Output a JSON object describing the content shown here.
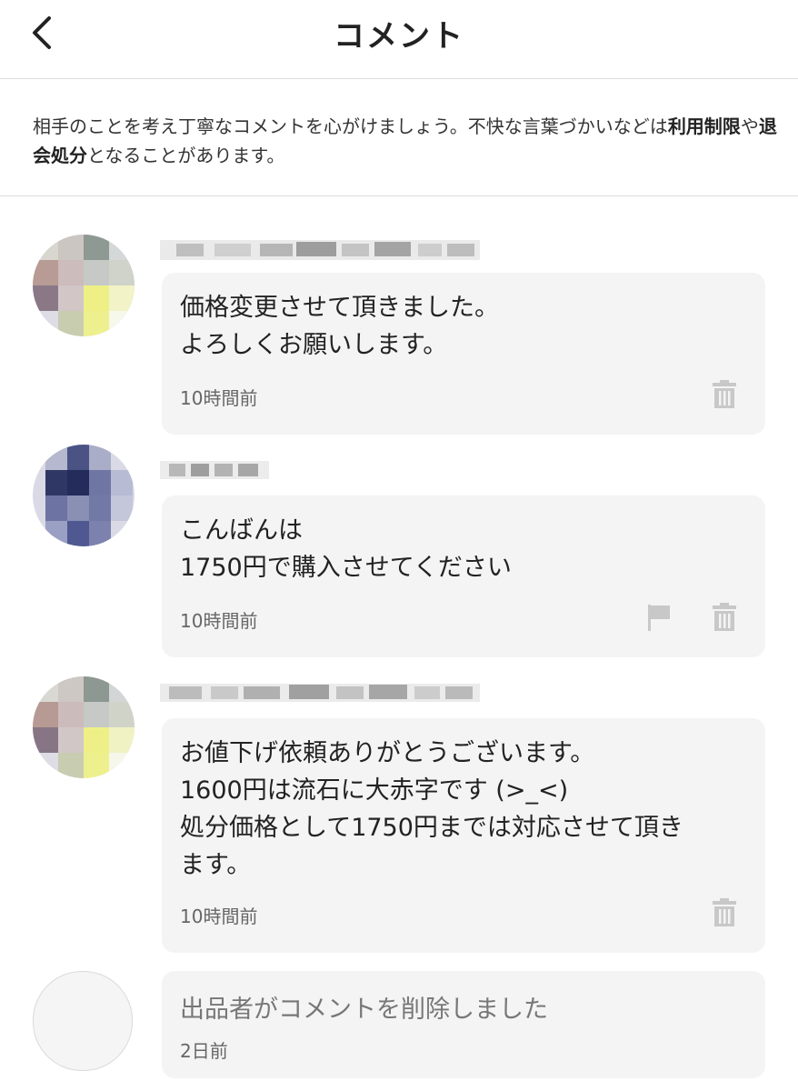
{
  "header": {
    "title": "コメント"
  },
  "notice": {
    "text_part1": "相手のことを考え丁寧なコメントを心がけましょう。不快な言葉づかいなどは",
    "bold1": "利用制限",
    "text_part2": "や",
    "bold2": "退会処分",
    "text_part3": "となることがあります。"
  },
  "comments": [
    {
      "body": "価格変更させて頂きました。\nよろしくお願いします。",
      "time": "10時間前",
      "icons": [
        "trash-icon"
      ]
    },
    {
      "body": "こんばんは\n1750円で購入させてください",
      "time": "10時間前",
      "icons": [
        "flag-icon",
        "trash-icon"
      ]
    },
    {
      "body": "お値下げ依頼ありがとうございます。\n1600円は流石に大赤字です (>_<)\n処分価格として1750円までは対応させて頂き\nます。",
      "time": "10時間前",
      "icons": [
        "trash-icon"
      ]
    },
    {
      "body": "出品者がコメントを削除しました",
      "time": "2日前",
      "deleted": true
    }
  ],
  "colors": {
    "bubble": "#f4f4f4",
    "divider": "#dcdcdc",
    "icon": "#c8c8c8"
  }
}
